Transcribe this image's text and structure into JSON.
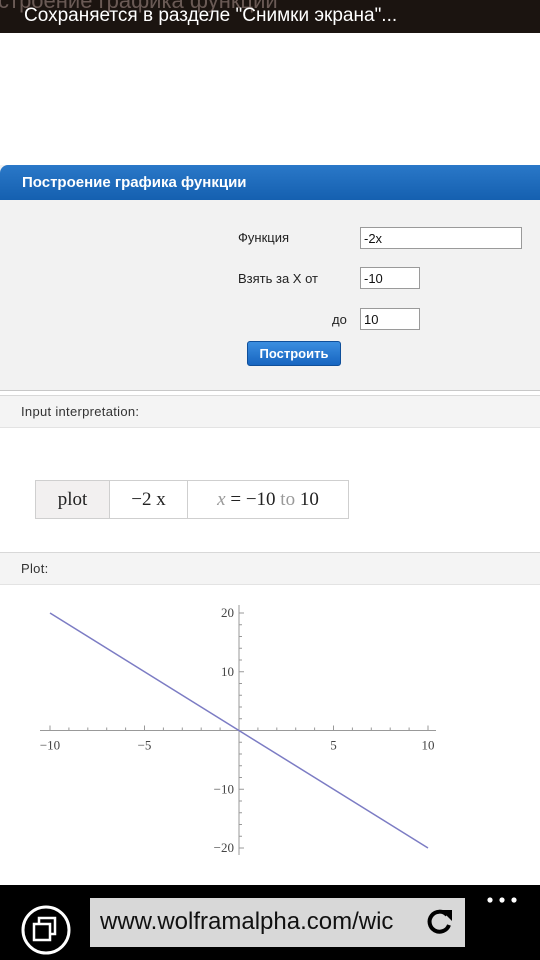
{
  "toast": {
    "ghost_text": "строение графика функции",
    "message": "Сохраняется в разделе \"Снимки экрана\"..."
  },
  "widget": {
    "title": "Построение графика функции",
    "function_label": "Функция",
    "function_value": "-2x",
    "from_label": "Взять за X от",
    "from_value": "-10",
    "to_label": "до",
    "to_value": "10",
    "build_button": "Построить"
  },
  "interpretation": {
    "header": "Input interpretation:",
    "cell_plot": "plot",
    "cell_expr": "−2 x",
    "cell_range_var": "x",
    "cell_range_eq": " = −10 ",
    "cell_range_to": "to",
    "cell_range_end": " 10"
  },
  "plot_pod": {
    "header": "Plot:"
  },
  "chart_data": {
    "type": "line",
    "series": [
      {
        "x": [
          -10,
          10
        ],
        "y": [
          20,
          -20
        ]
      }
    ],
    "x_ticks": [
      -10,
      -5,
      5,
      10
    ],
    "y_ticks": [
      20,
      10,
      -10,
      -20
    ],
    "xlim": [
      -10,
      10
    ],
    "ylim": [
      -20,
      20
    ],
    "line_color": "#7c7cc4",
    "grid": false
  },
  "browser": {
    "url": "www.wolframalpha.com/wic"
  },
  "icons": {
    "tabs": "tabs-icon",
    "reload": "reload-icon",
    "more": "more-icon"
  }
}
